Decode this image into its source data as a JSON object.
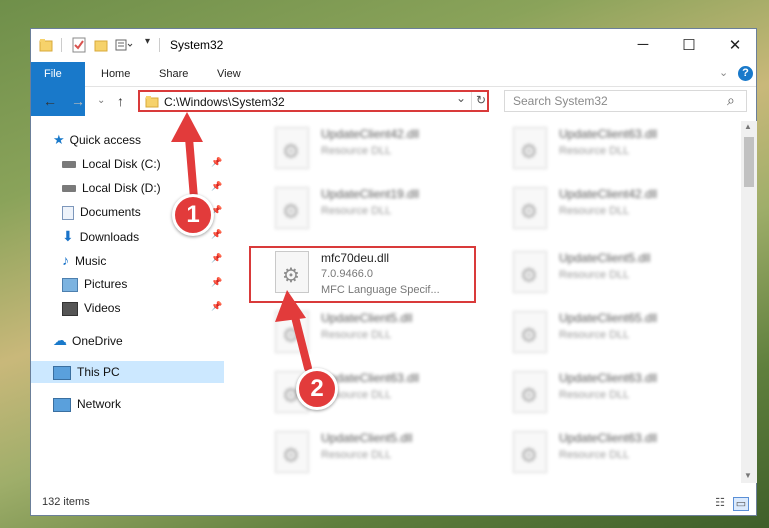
{
  "window": {
    "title": "System32",
    "controls": {
      "minimize": "─",
      "maximize": "☐",
      "close": "✕"
    }
  },
  "ribbon": {
    "tabs": [
      "File",
      "Home",
      "Share",
      "View"
    ],
    "expand_icon": "chevron-down-icon",
    "help": "?"
  },
  "address": {
    "path": "C:\\Windows\\System32",
    "dropdown": "⌄",
    "refresh": "↻"
  },
  "search": {
    "placeholder": "Search System32",
    "icon": "⌕"
  },
  "sidebar": {
    "quick_access": "Quick access",
    "items": [
      {
        "label": "Local Disk (C:)",
        "icon": "drive-icon",
        "pinned": true
      },
      {
        "label": "Local Disk (D:)",
        "icon": "drive-icon",
        "pinned": true
      },
      {
        "label": "Documents",
        "icon": "documents-icon",
        "pinned": true
      },
      {
        "label": "Downloads",
        "icon": "downloads-icon",
        "pinned": true
      },
      {
        "label": "Music",
        "icon": "music-icon",
        "pinned": true
      },
      {
        "label": "Pictures",
        "icon": "pictures-icon",
        "pinned": true
      },
      {
        "label": "Videos",
        "icon": "videos-icon",
        "pinned": true
      }
    ],
    "onedrive": "OneDrive",
    "this_pc": "This PC",
    "network": "Network"
  },
  "files": {
    "left": [
      {
        "name": "UpdateClient42.dll",
        "type": "Resource DLL"
      },
      {
        "name": "UpdateClient19.dll",
        "type": "Resource DLL"
      },
      {
        "name": "mfc70deu.dll",
        "version": "7.0.9466.0",
        "desc": "MFC Language Specif...",
        "selected": true
      },
      {
        "name": "UpdateClient5.dll",
        "type": "Resource DLL"
      },
      {
        "name": "UpdateClient63.dll",
        "type": "Resource DLL"
      },
      {
        "name": "UpdateClient5.dll",
        "type": "Resource DLL"
      }
    ],
    "right": [
      {
        "name": "UpdateClient63.dll",
        "type": "Resource DLL"
      },
      {
        "name": "UpdateClient42.dll",
        "type": "Resource DLL"
      },
      {
        "name": "UpdateClient5.dll",
        "type": "Resource DLL"
      },
      {
        "name": "UpdateClient65.dll",
        "type": "Resource DLL"
      },
      {
        "name": "UpdateClient63.dll",
        "type": "Resource DLL"
      },
      {
        "name": "UpdateClient63.dll",
        "type": "Resource DLL"
      }
    ]
  },
  "status": {
    "item_count": "132 items"
  },
  "annotations": {
    "step1": "1",
    "step2": "2",
    "color": "#e23b3b"
  }
}
